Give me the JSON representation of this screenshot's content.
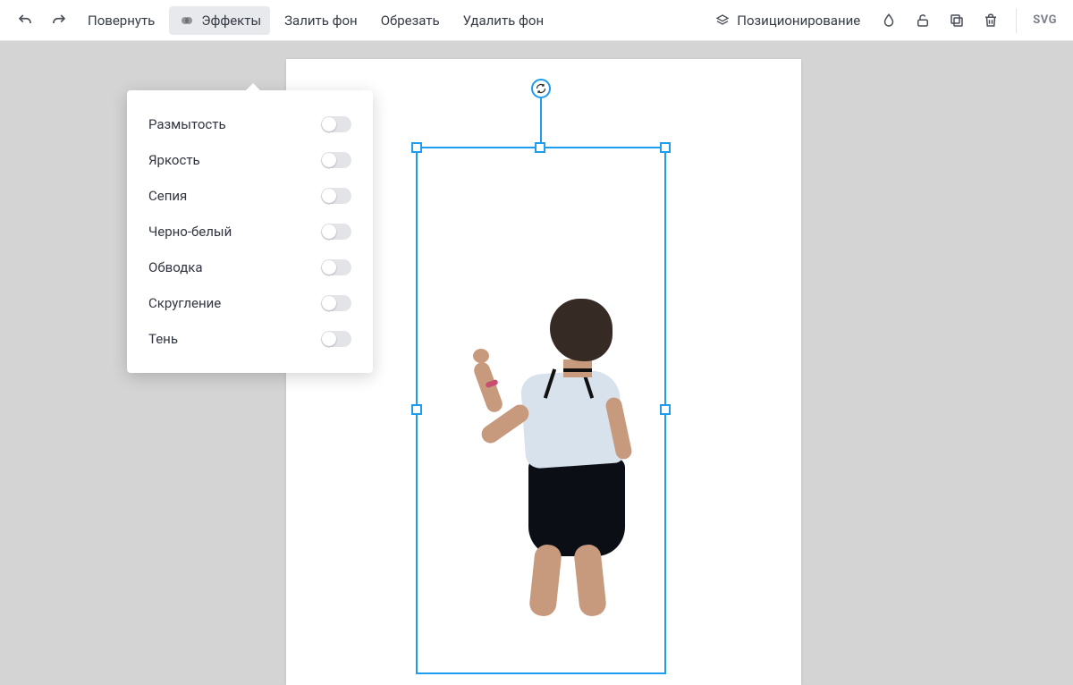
{
  "toolbar": {
    "rotate": "Повернуть",
    "effects": "Эффекты",
    "fill_bg": "Залить фон",
    "crop": "Обрезать",
    "remove_bg": "Удалить фон",
    "positioning": "Позиционирование",
    "svg_badge": "SVG"
  },
  "effects_menu": {
    "items": [
      {
        "label": "Размытость",
        "on": false
      },
      {
        "label": "Яркость",
        "on": false
      },
      {
        "label": "Сепия",
        "on": false
      },
      {
        "label": "Черно-белый",
        "on": false
      },
      {
        "label": "Обводка",
        "on": false
      },
      {
        "label": "Скругление",
        "on": false
      },
      {
        "label": "Тень",
        "on": false
      }
    ]
  },
  "colors": {
    "selection": "#1e9cf0"
  }
}
